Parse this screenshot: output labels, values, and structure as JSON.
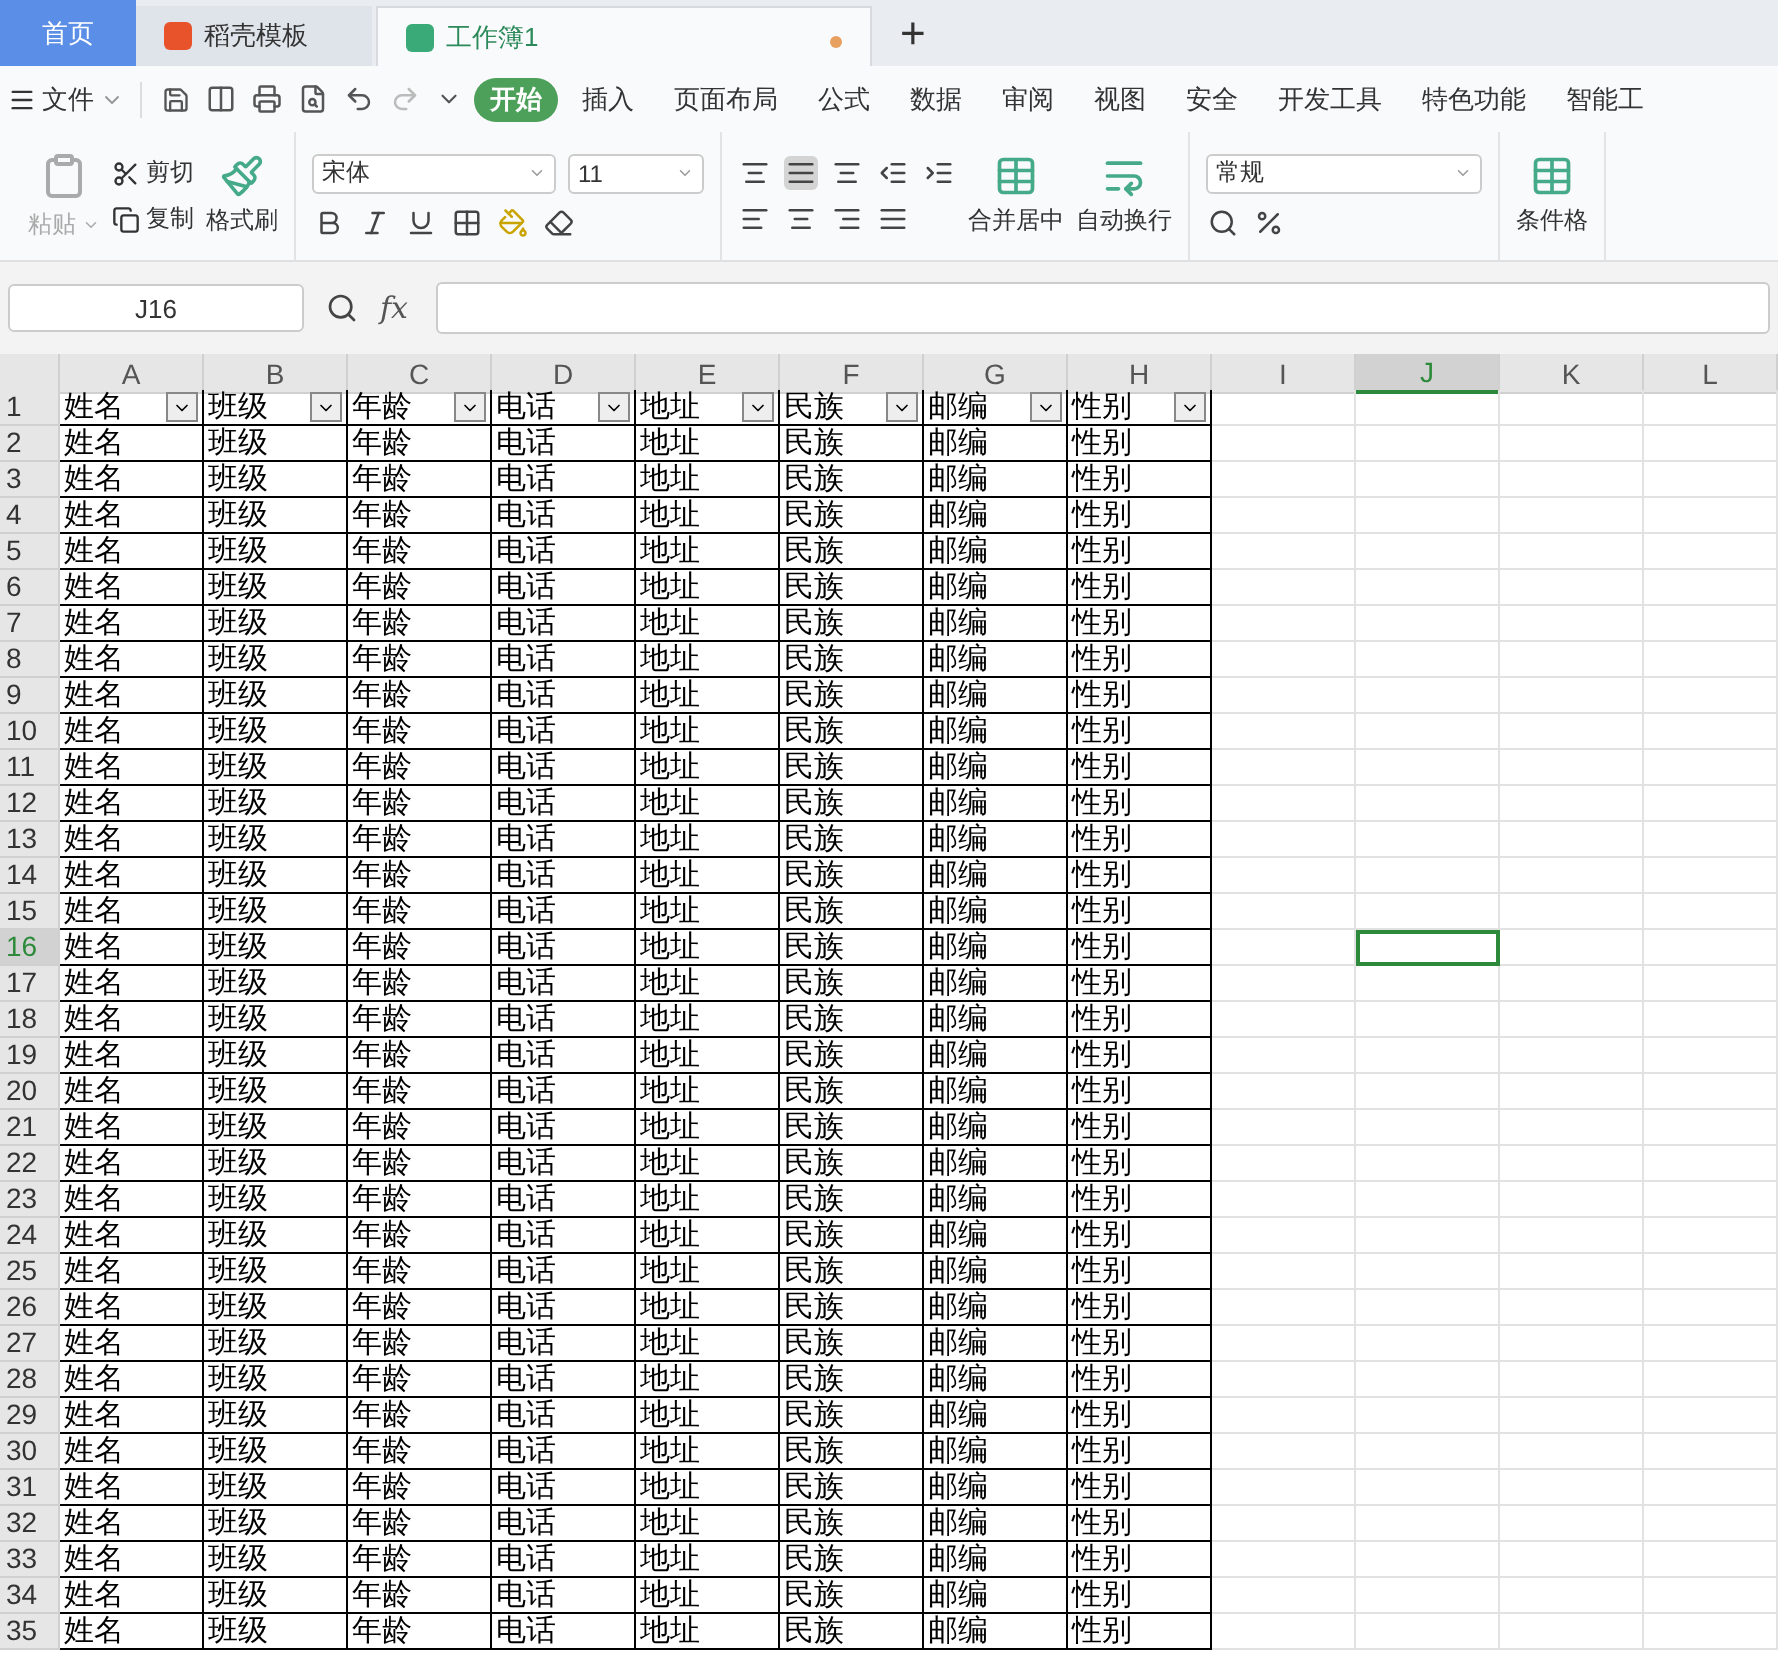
{
  "tabs": [
    {
      "label": "首页",
      "kind": "home",
      "selected": false
    },
    {
      "label": "稻壳模板",
      "kind": "docer",
      "selected": false
    },
    {
      "label": "工作簿1",
      "kind": "sheet",
      "selected": true
    }
  ],
  "new_tab": "+",
  "file_menu": "文件",
  "menu": [
    {
      "label": "开始",
      "selected": true
    },
    {
      "label": "插入",
      "selected": false
    },
    {
      "label": "页面布局",
      "selected": false
    },
    {
      "label": "公式",
      "selected": false
    },
    {
      "label": "数据",
      "selected": false
    },
    {
      "label": "审阅",
      "selected": false
    },
    {
      "label": "视图",
      "selected": false
    },
    {
      "label": "安全",
      "selected": false
    },
    {
      "label": "开发工具",
      "selected": false
    },
    {
      "label": "特色功能",
      "selected": false
    },
    {
      "label": "智能工",
      "selected": false
    }
  ],
  "ribbon": {
    "paste": "粘贴",
    "cut": "剪切",
    "copy": "复制",
    "format_painter": "格式刷",
    "font": "宋体",
    "font_size": "11",
    "merge": "合并居中",
    "wrap": "自动换行",
    "number_format": "常规",
    "conditional": "条件格"
  },
  "formula_bar": {
    "cell_ref": "J16",
    "fx": "fx"
  },
  "columns": [
    {
      "label": "A",
      "selected": false
    },
    {
      "label": "B",
      "selected": false
    },
    {
      "label": "C",
      "selected": false
    },
    {
      "label": "D",
      "selected": false
    },
    {
      "label": "E",
      "selected": false
    },
    {
      "label": "F",
      "selected": false
    },
    {
      "label": "G",
      "selected": false
    },
    {
      "label": "H",
      "selected": false
    },
    {
      "label": "I",
      "selected": false
    },
    {
      "label": "J",
      "selected": true
    },
    {
      "label": "K",
      "selected": false
    },
    {
      "label": "L",
      "selected": false
    }
  ],
  "rows": [
    {
      "number": "1",
      "selected": false,
      "filter": true,
      "cells": [
        "姓名",
        "班级",
        "年龄",
        "电话",
        "地址",
        "民族",
        "邮编",
        "性别"
      ]
    },
    {
      "number": "2",
      "selected": false,
      "filter": false,
      "cells": [
        "姓名",
        "班级",
        "年龄",
        "电话",
        "地址",
        "民族",
        "邮编",
        "性别"
      ]
    },
    {
      "number": "3",
      "selected": false,
      "filter": false,
      "cells": [
        "姓名",
        "班级",
        "年龄",
        "电话",
        "地址",
        "民族",
        "邮编",
        "性别"
      ]
    },
    {
      "number": "4",
      "selected": false,
      "filter": false,
      "cells": [
        "姓名",
        "班级",
        "年龄",
        "电话",
        "地址",
        "民族",
        "邮编",
        "性别"
      ]
    },
    {
      "number": "5",
      "selected": false,
      "filter": false,
      "cells": [
        "姓名",
        "班级",
        "年龄",
        "电话",
        "地址",
        "民族",
        "邮编",
        "性别"
      ]
    },
    {
      "number": "6",
      "selected": false,
      "filter": false,
      "cells": [
        "姓名",
        "班级",
        "年龄",
        "电话",
        "地址",
        "民族",
        "邮编",
        "性别"
      ]
    },
    {
      "number": "7",
      "selected": false,
      "filter": false,
      "cells": [
        "姓名",
        "班级",
        "年龄",
        "电话",
        "地址",
        "民族",
        "邮编",
        "性别"
      ]
    },
    {
      "number": "8",
      "selected": false,
      "filter": false,
      "cells": [
        "姓名",
        "班级",
        "年龄",
        "电话",
        "地址",
        "民族",
        "邮编",
        "性别"
      ]
    },
    {
      "number": "9",
      "selected": false,
      "filter": false,
      "cells": [
        "姓名",
        "班级",
        "年龄",
        "电话",
        "地址",
        "民族",
        "邮编",
        "性别"
      ]
    },
    {
      "number": "10",
      "selected": false,
      "filter": false,
      "cells": [
        "姓名",
        "班级",
        "年龄",
        "电话",
        "地址",
        "民族",
        "邮编",
        "性别"
      ]
    },
    {
      "number": "11",
      "selected": false,
      "filter": false,
      "cells": [
        "姓名",
        "班级",
        "年龄",
        "电话",
        "地址",
        "民族",
        "邮编",
        "性别"
      ]
    },
    {
      "number": "12",
      "selected": false,
      "filter": false,
      "cells": [
        "姓名",
        "班级",
        "年龄",
        "电话",
        "地址",
        "民族",
        "邮编",
        "性别"
      ]
    },
    {
      "number": "13",
      "selected": false,
      "filter": false,
      "cells": [
        "姓名",
        "班级",
        "年龄",
        "电话",
        "地址",
        "民族",
        "邮编",
        "性别"
      ]
    },
    {
      "number": "14",
      "selected": false,
      "filter": false,
      "cells": [
        "姓名",
        "班级",
        "年龄",
        "电话",
        "地址",
        "民族",
        "邮编",
        "性别"
      ]
    },
    {
      "number": "15",
      "selected": false,
      "filter": false,
      "cells": [
        "姓名",
        "班级",
        "年龄",
        "电话",
        "地址",
        "民族",
        "邮编",
        "性别"
      ]
    },
    {
      "number": "16",
      "selected": true,
      "filter": false,
      "cells": [
        "姓名",
        "班级",
        "年龄",
        "电话",
        "地址",
        "民族",
        "邮编",
        "性别"
      ]
    },
    {
      "number": "17",
      "selected": false,
      "filter": false,
      "cells": [
        "姓名",
        "班级",
        "年龄",
        "电话",
        "地址",
        "民族",
        "邮编",
        "性别"
      ]
    },
    {
      "number": "18",
      "selected": false,
      "filter": false,
      "cells": [
        "姓名",
        "班级",
        "年龄",
        "电话",
        "地址",
        "民族",
        "邮编",
        "性别"
      ]
    },
    {
      "number": "19",
      "selected": false,
      "filter": false,
      "cells": [
        "姓名",
        "班级",
        "年龄",
        "电话",
        "地址",
        "民族",
        "邮编",
        "性别"
      ]
    },
    {
      "number": "20",
      "selected": false,
      "filter": false,
      "cells": [
        "姓名",
        "班级",
        "年龄",
        "电话",
        "地址",
        "民族",
        "邮编",
        "性别"
      ]
    },
    {
      "number": "21",
      "selected": false,
      "filter": false,
      "cells": [
        "姓名",
        "班级",
        "年龄",
        "电话",
        "地址",
        "民族",
        "邮编",
        "性别"
      ]
    },
    {
      "number": "22",
      "selected": false,
      "filter": false,
      "cells": [
        "姓名",
        "班级",
        "年龄",
        "电话",
        "地址",
        "民族",
        "邮编",
        "性别"
      ]
    },
    {
      "number": "23",
      "selected": false,
      "filter": false,
      "cells": [
        "姓名",
        "班级",
        "年龄",
        "电话",
        "地址",
        "民族",
        "邮编",
        "性别"
      ]
    },
    {
      "number": "24",
      "selected": false,
      "filter": false,
      "cells": [
        "姓名",
        "班级",
        "年龄",
        "电话",
        "地址",
        "民族",
        "邮编",
        "性别"
      ]
    },
    {
      "number": "25",
      "selected": false,
      "filter": false,
      "cells": [
        "姓名",
        "班级",
        "年龄",
        "电话",
        "地址",
        "民族",
        "邮编",
        "性别"
      ]
    },
    {
      "number": "26",
      "selected": false,
      "filter": false,
      "cells": [
        "姓名",
        "班级",
        "年龄",
        "电话",
        "地址",
        "民族",
        "邮编",
        "性别"
      ]
    },
    {
      "number": "27",
      "selected": false,
      "filter": false,
      "cells": [
        "姓名",
        "班级",
        "年龄",
        "电话",
        "地址",
        "民族",
        "邮编",
        "性别"
      ]
    },
    {
      "number": "28",
      "selected": false,
      "filter": false,
      "cells": [
        "姓名",
        "班级",
        "年龄",
        "电话",
        "地址",
        "民族",
        "邮编",
        "性别"
      ]
    },
    {
      "number": "29",
      "selected": false,
      "filter": false,
      "cells": [
        "姓名",
        "班级",
        "年龄",
        "电话",
        "地址",
        "民族",
        "邮编",
        "性别"
      ]
    },
    {
      "number": "30",
      "selected": false,
      "filter": false,
      "cells": [
        "姓名",
        "班级",
        "年龄",
        "电话",
        "地址",
        "民族",
        "邮编",
        "性别"
      ]
    },
    {
      "number": "31",
      "selected": false,
      "filter": false,
      "cells": [
        "姓名",
        "班级",
        "年龄",
        "电话",
        "地址",
        "民族",
        "邮编",
        "性别"
      ]
    },
    {
      "number": "32",
      "selected": false,
      "filter": false,
      "cells": [
        "姓名",
        "班级",
        "年龄",
        "电话",
        "地址",
        "民族",
        "邮编",
        "性别"
      ]
    },
    {
      "number": "33",
      "selected": false,
      "filter": false,
      "cells": [
        "姓名",
        "班级",
        "年龄",
        "电话",
        "地址",
        "民族",
        "邮编",
        "性别"
      ]
    },
    {
      "number": "34",
      "selected": false,
      "filter": false,
      "cells": [
        "姓名",
        "班级",
        "年龄",
        "电话",
        "地址",
        "民族",
        "邮编",
        "性别"
      ]
    },
    {
      "number": "35",
      "selected": false,
      "filter": false,
      "cells": [
        "姓名",
        "班级",
        "年龄",
        "电话",
        "地址",
        "民族",
        "邮编",
        "性别"
      ]
    }
  ]
}
